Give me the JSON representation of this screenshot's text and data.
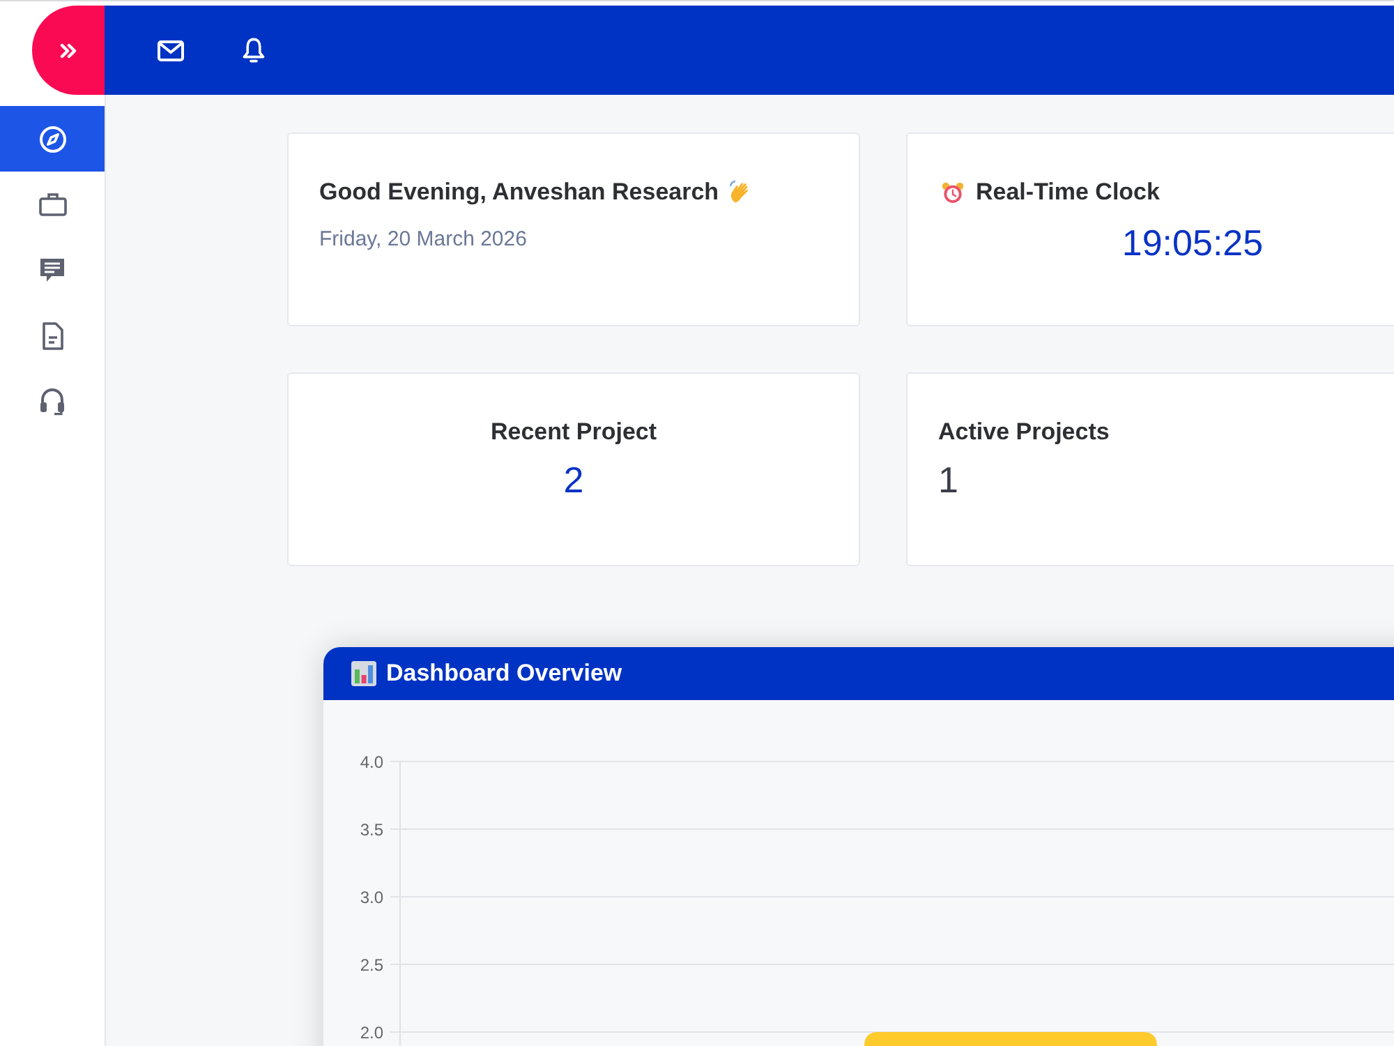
{
  "sidebar": {
    "items": [
      {
        "selected": true
      },
      {
        "selected": false
      },
      {
        "selected": false
      },
      {
        "selected": false
      },
      {
        "selected": false
      }
    ]
  },
  "greeting": {
    "title": "Good Evening, Anveshan Research",
    "date": "Friday, 20 March 2026"
  },
  "clock": {
    "title": "Real-Time Clock",
    "time": "19:05:25"
  },
  "stats": [
    {
      "kind": "centered",
      "label": "Recent Project",
      "value": "2"
    },
    {
      "kind": "plain",
      "label": "Active Projects",
      "value": "1"
    }
  ],
  "chart_panel": {
    "title": "Dashboard Overview",
    "chart_data": {
      "type": "bar",
      "ylim": [
        0,
        4
      ],
      "grid": true,
      "yticks": [
        {
          "value": 2,
          "label": "2.0"
        },
        {
          "value": 2.5,
          "label": "2.5"
        },
        {
          "value": 3,
          "label": "3.0"
        },
        {
          "value": 3.5,
          "label": "3.5"
        },
        {
          "value": 4,
          "label": "4.0"
        }
      ],
      "series": [
        {
          "color": "#ffca2c",
          "values": [
            null,
            2
          ]
        }
      ]
    }
  }
}
